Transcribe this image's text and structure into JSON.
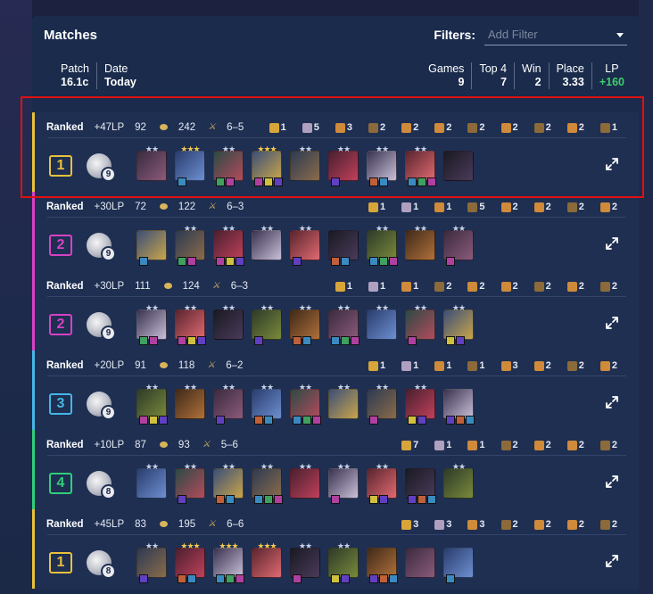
{
  "header": {
    "title": "Matches",
    "filters_label": "Filters:",
    "filter_placeholder": "Add Filter"
  },
  "stats": {
    "patch_label": "Patch",
    "patch_value": "16.1c",
    "date_label": "Date",
    "date_value": "Today",
    "games_label": "Games",
    "games_value": "9",
    "top4_label": "Top 4",
    "top4_value": "7",
    "win_label": "Win",
    "win_value": "2",
    "place_label": "Place",
    "place_value": "3.33",
    "lp_label": "LP",
    "lp_value": "+160"
  },
  "colors": {
    "place_1": "#e8c13c",
    "place_2": "#d642c4",
    "place_3": "#45b6e6",
    "place_4": "#2fcf7a",
    "lp_positive": "#3ecf6a",
    "highlight": "#e01010"
  },
  "matches": [
    {
      "queue": "Ranked",
      "lp": "+47LP",
      "gold": "92",
      "damage": "242",
      "record": "6–5",
      "place": "1",
      "level": "9",
      "accent": "#e8c13c",
      "traits": [
        "1",
        "5",
        "3",
        "2",
        "2",
        "2",
        "2",
        "2",
        "2",
        "2",
        "1"
      ],
      "unit_count": 9
    },
    {
      "queue": "Ranked",
      "lp": "+30LP",
      "gold": "72",
      "damage": "122",
      "record": "6–3",
      "place": "2",
      "level": "9",
      "accent": "#d642c4",
      "traits": [
        "1",
        "1",
        "1",
        "5",
        "2",
        "2",
        "2",
        "2"
      ],
      "unit_count": 9
    },
    {
      "queue": "Ranked",
      "lp": "+30LP",
      "gold": "111",
      "damage": "124",
      "record": "6–3",
      "place": "2",
      "level": "9",
      "accent": "#d642c4",
      "traits": [
        "1",
        "1",
        "1",
        "2",
        "2",
        "2",
        "2",
        "2",
        "2"
      ],
      "unit_count": 9
    },
    {
      "queue": "Ranked",
      "lp": "+20LP",
      "gold": "91",
      "damage": "118",
      "record": "6–2",
      "place": "3",
      "level": "9",
      "accent": "#45b6e6",
      "traits": [
        "1",
        "1",
        "1",
        "1",
        "3",
        "2",
        "2",
        "2"
      ],
      "unit_count": 9
    },
    {
      "queue": "Ranked",
      "lp": "+10LP",
      "gold": "87",
      "damage": "93",
      "record": "5–6",
      "place": "4",
      "level": "8",
      "accent": "#2fcf7a",
      "traits": [
        "7",
        "1",
        "1",
        "2",
        "2",
        "2",
        "2"
      ],
      "unit_count": 9
    },
    {
      "queue": "Ranked",
      "lp": "+45LP",
      "gold": "83",
      "damage": "195",
      "record": "6–6",
      "place": "1",
      "level": "8",
      "accent": "#e8c13c",
      "traits": [
        "3",
        "3",
        "3",
        "2",
        "2",
        "2",
        "2"
      ],
      "unit_count": 9
    }
  ]
}
